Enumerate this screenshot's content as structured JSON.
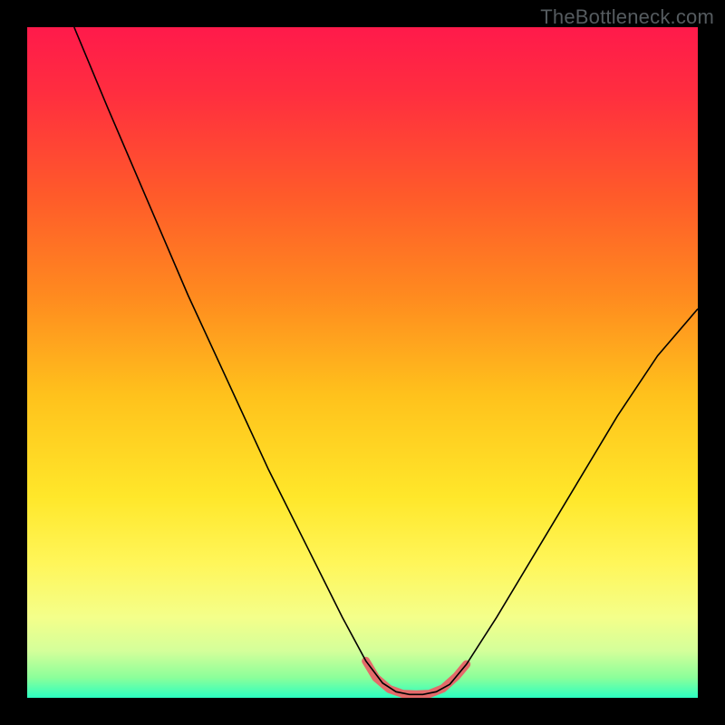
{
  "attribution": "TheBottleneck.com",
  "chart_data": {
    "type": "line",
    "title": "",
    "xlabel": "",
    "ylabel": "",
    "xlim": [
      0,
      100
    ],
    "ylim": [
      0,
      100
    ],
    "background_gradient_stops": [
      {
        "offset": 0.0,
        "color": "#ff1a4b"
      },
      {
        "offset": 0.1,
        "color": "#ff2e3f"
      },
      {
        "offset": 0.25,
        "color": "#ff5a2a"
      },
      {
        "offset": 0.4,
        "color": "#ff8a1f"
      },
      {
        "offset": 0.55,
        "color": "#ffc21c"
      },
      {
        "offset": 0.7,
        "color": "#ffe72a"
      },
      {
        "offset": 0.8,
        "color": "#fff65a"
      },
      {
        "offset": 0.88,
        "color": "#f4ff8a"
      },
      {
        "offset": 0.93,
        "color": "#d4ff9a"
      },
      {
        "offset": 0.97,
        "color": "#8bff9a"
      },
      {
        "offset": 1.0,
        "color": "#2bffc1"
      }
    ],
    "series": [
      {
        "name": "bottleneck-curve",
        "stroke": "#000000",
        "stroke_width": 1.6,
        "points": [
          {
            "x": 7.0,
            "y": 100.0
          },
          {
            "x": 12.0,
            "y": 88.0
          },
          {
            "x": 18.0,
            "y": 74.0
          },
          {
            "x": 24.0,
            "y": 60.0
          },
          {
            "x": 30.0,
            "y": 47.0
          },
          {
            "x": 36.0,
            "y": 34.0
          },
          {
            "x": 42.0,
            "y": 22.0
          },
          {
            "x": 47.0,
            "y": 12.0
          },
          {
            "x": 50.5,
            "y": 5.5
          },
          {
            "x": 53.0,
            "y": 2.2
          },
          {
            "x": 55.0,
            "y": 0.9
          },
          {
            "x": 57.0,
            "y": 0.5
          },
          {
            "x": 59.0,
            "y": 0.5
          },
          {
            "x": 61.0,
            "y": 0.9
          },
          {
            "x": 63.0,
            "y": 2.0
          },
          {
            "x": 65.5,
            "y": 5.0
          },
          {
            "x": 70.0,
            "y": 12.0
          },
          {
            "x": 76.0,
            "y": 22.0
          },
          {
            "x": 82.0,
            "y": 32.0
          },
          {
            "x": 88.0,
            "y": 42.0
          },
          {
            "x": 94.0,
            "y": 51.0
          },
          {
            "x": 100.0,
            "y": 58.0
          }
        ]
      },
      {
        "name": "optimal-zone-highlight",
        "stroke": "#e36a6a",
        "stroke_width": 9,
        "linecap": "round",
        "points": [
          {
            "x": 50.5,
            "y": 5.5
          },
          {
            "x": 52.0,
            "y": 3.0
          },
          {
            "x": 54.0,
            "y": 1.3
          },
          {
            "x": 56.0,
            "y": 0.6
          },
          {
            "x": 58.0,
            "y": 0.5
          },
          {
            "x": 60.0,
            "y": 0.6
          },
          {
            "x": 62.0,
            "y": 1.4
          },
          {
            "x": 64.0,
            "y": 3.2
          },
          {
            "x": 65.5,
            "y": 5.0
          }
        ]
      }
    ]
  }
}
